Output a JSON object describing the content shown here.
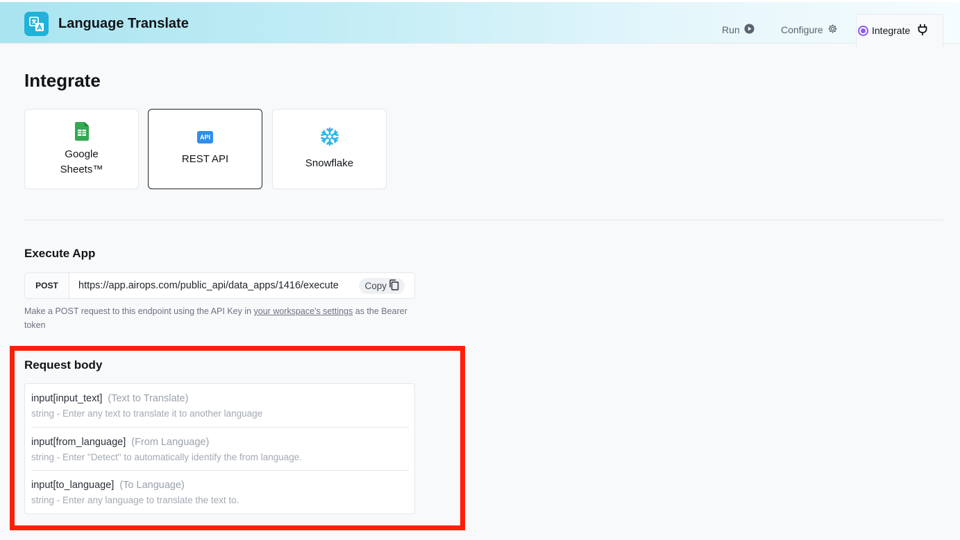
{
  "app": {
    "title": "Language Translate",
    "logo_icon": "translate-icon"
  },
  "nav": {
    "run_label": "Run",
    "configure_label": "Configure",
    "integrate_label": "Integrate"
  },
  "page": {
    "title": "Integrate"
  },
  "integrations": [
    {
      "label_line1": "Google",
      "label_line2": "Sheets™",
      "icon": "google-sheets-icon"
    },
    {
      "label": "REST API",
      "icon": "api-icon",
      "icon_text": "API",
      "selected": true
    },
    {
      "label": "Snowflake",
      "icon": "snowflake-icon"
    }
  ],
  "execute": {
    "title": "Execute App",
    "method": "POST",
    "url": "https://app.airops.com/public_api/data_apps/1416/execute",
    "copy_label": "Copy",
    "hint_before": "Make a POST request to this endpoint using the API Key in ",
    "hint_link": "your workspace's settings",
    "hint_after": " as the Bearer token"
  },
  "request_body": {
    "title": "Request body",
    "params": [
      {
        "name": "input[input_text]",
        "label": "(Text to Translate)",
        "desc": "string - Enter any text to translate it to another language"
      },
      {
        "name": "input[from_language]",
        "label": "(From Language)",
        "desc": "string - Enter \"Detect\" to automatically identify the from language."
      },
      {
        "name": "input[to_language]",
        "label": "(To Language)",
        "desc": "string - Enter any language to translate the text to."
      }
    ]
  },
  "colors": {
    "accent": "#8b5cf6",
    "highlight": "#ff1e0a",
    "logo_bg": "#1fb3d9",
    "sheets_green": "#34a853",
    "api_blue": "#2f8fe8",
    "snowflake_blue": "#29b5e8"
  }
}
